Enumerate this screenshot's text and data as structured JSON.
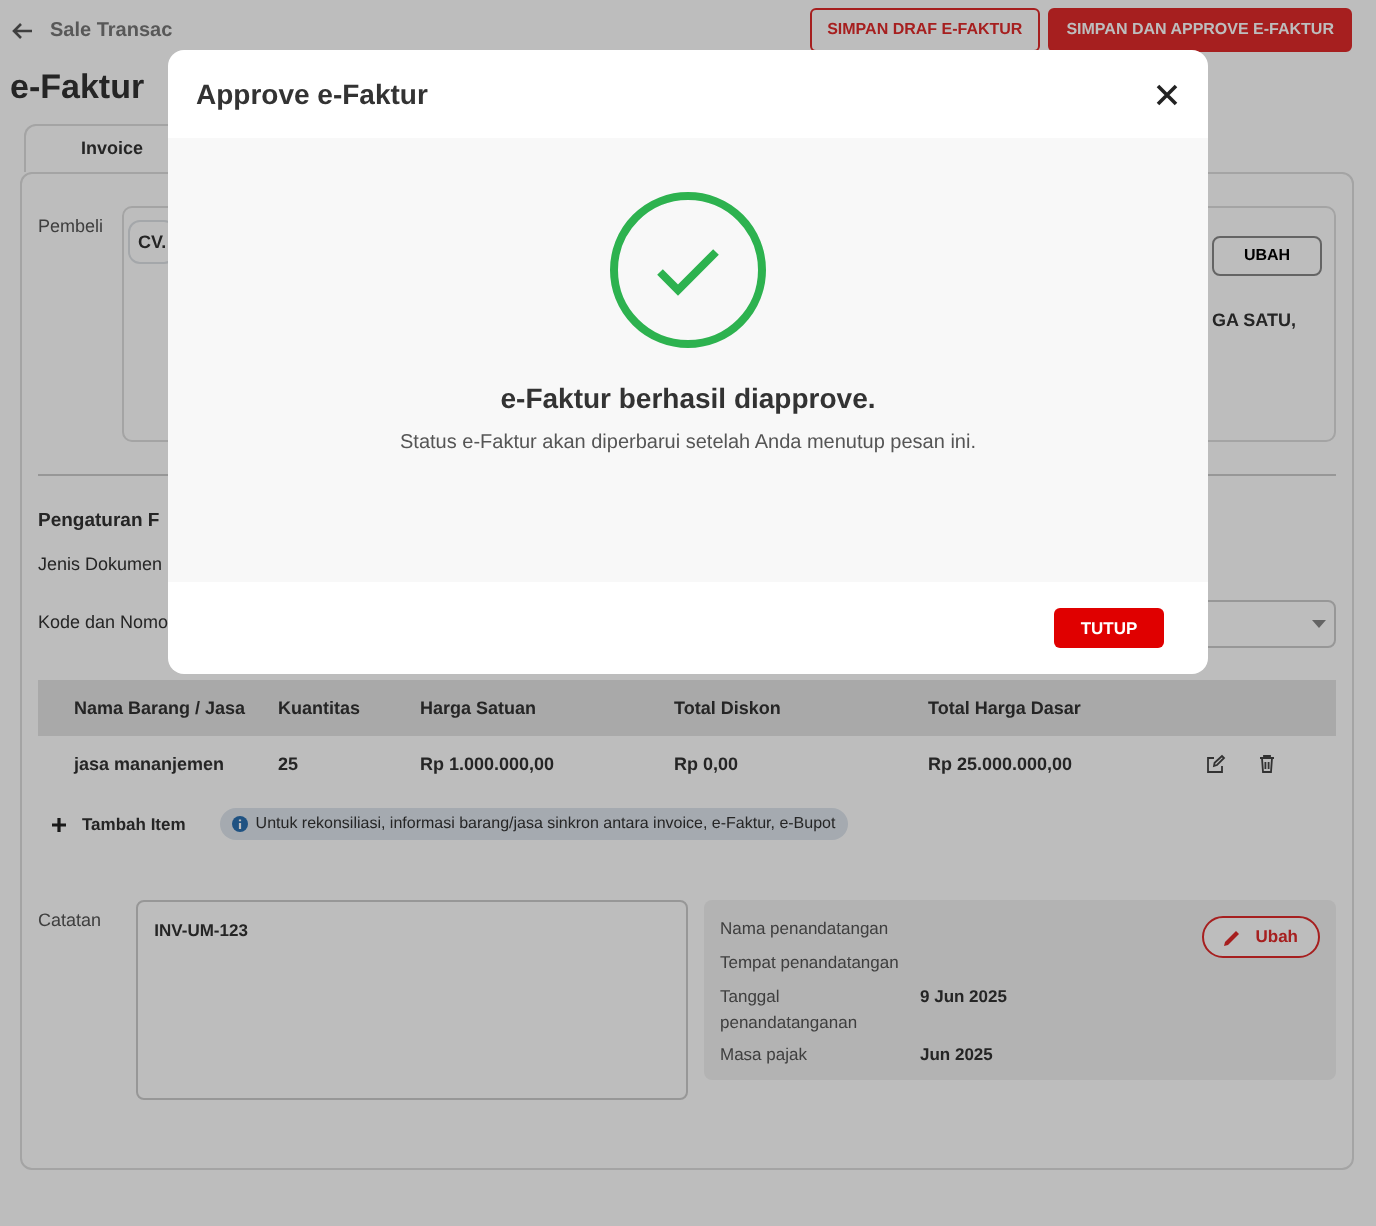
{
  "header": {
    "breadcrumb": "Sale Transac",
    "buttons": [
      {
        "label": "SIMPAN DRAF E-FAKTUR",
        "kind": "outline"
      },
      {
        "label": "SIMPAN DAN APPROVE E-FAKTUR",
        "kind": "primary"
      }
    ]
  },
  "page_title": "e-Faktur",
  "tabs": [
    {
      "label": "Invoice",
      "selected": true
    }
  ],
  "buyer": {
    "label": "Pembeli",
    "value": "CV.",
    "button": "UBAH",
    "address": "GA SATU,"
  },
  "settings": {
    "title": "Pengaturan F",
    "fields": [
      {
        "label": "Jenis Dokumen",
        "kind": "text"
      },
      {
        "label": "Kode dan Nomo",
        "kind": "select"
      }
    ]
  },
  "table": {
    "columns": [
      "Nama Barang / Jasa",
      "Kuantitas",
      "Harga Satuan",
      "Total Diskon",
      "Total Harga Dasar"
    ],
    "rows": [
      {
        "cells": [
          "jasa mananjemen",
          "25",
          "Rp 1.000.000,00",
          "Rp 0,00",
          "Rp 25.000.000,00"
        ]
      }
    ]
  },
  "add_item": "Tambah Item",
  "info": "Untuk rekonsiliasi, informasi barang/jasa sinkron antara invoice, e-Faktur, e-Bupot",
  "notes": {
    "label": "Catatan",
    "value": "INV-UM-123"
  },
  "signature": {
    "button": "Ubah",
    "rows": [
      {
        "label": "Nama penandatangan"
      },
      {
        "label": "Tempat penandatangan"
      },
      {
        "label": "Tanggal penandatanganan",
        "value": "9 Jun 2025"
      },
      {
        "label": "Masa pajak",
        "value": "Jun 2025"
      }
    ]
  },
  "modal": {
    "title": "Approve e-Faktur",
    "heading": "e-Faktur berhasil diapprove.",
    "message": "Status e-Faktur akan diperbarui setelah Anda menutup pesan ini.",
    "button": "TUTUP"
  }
}
